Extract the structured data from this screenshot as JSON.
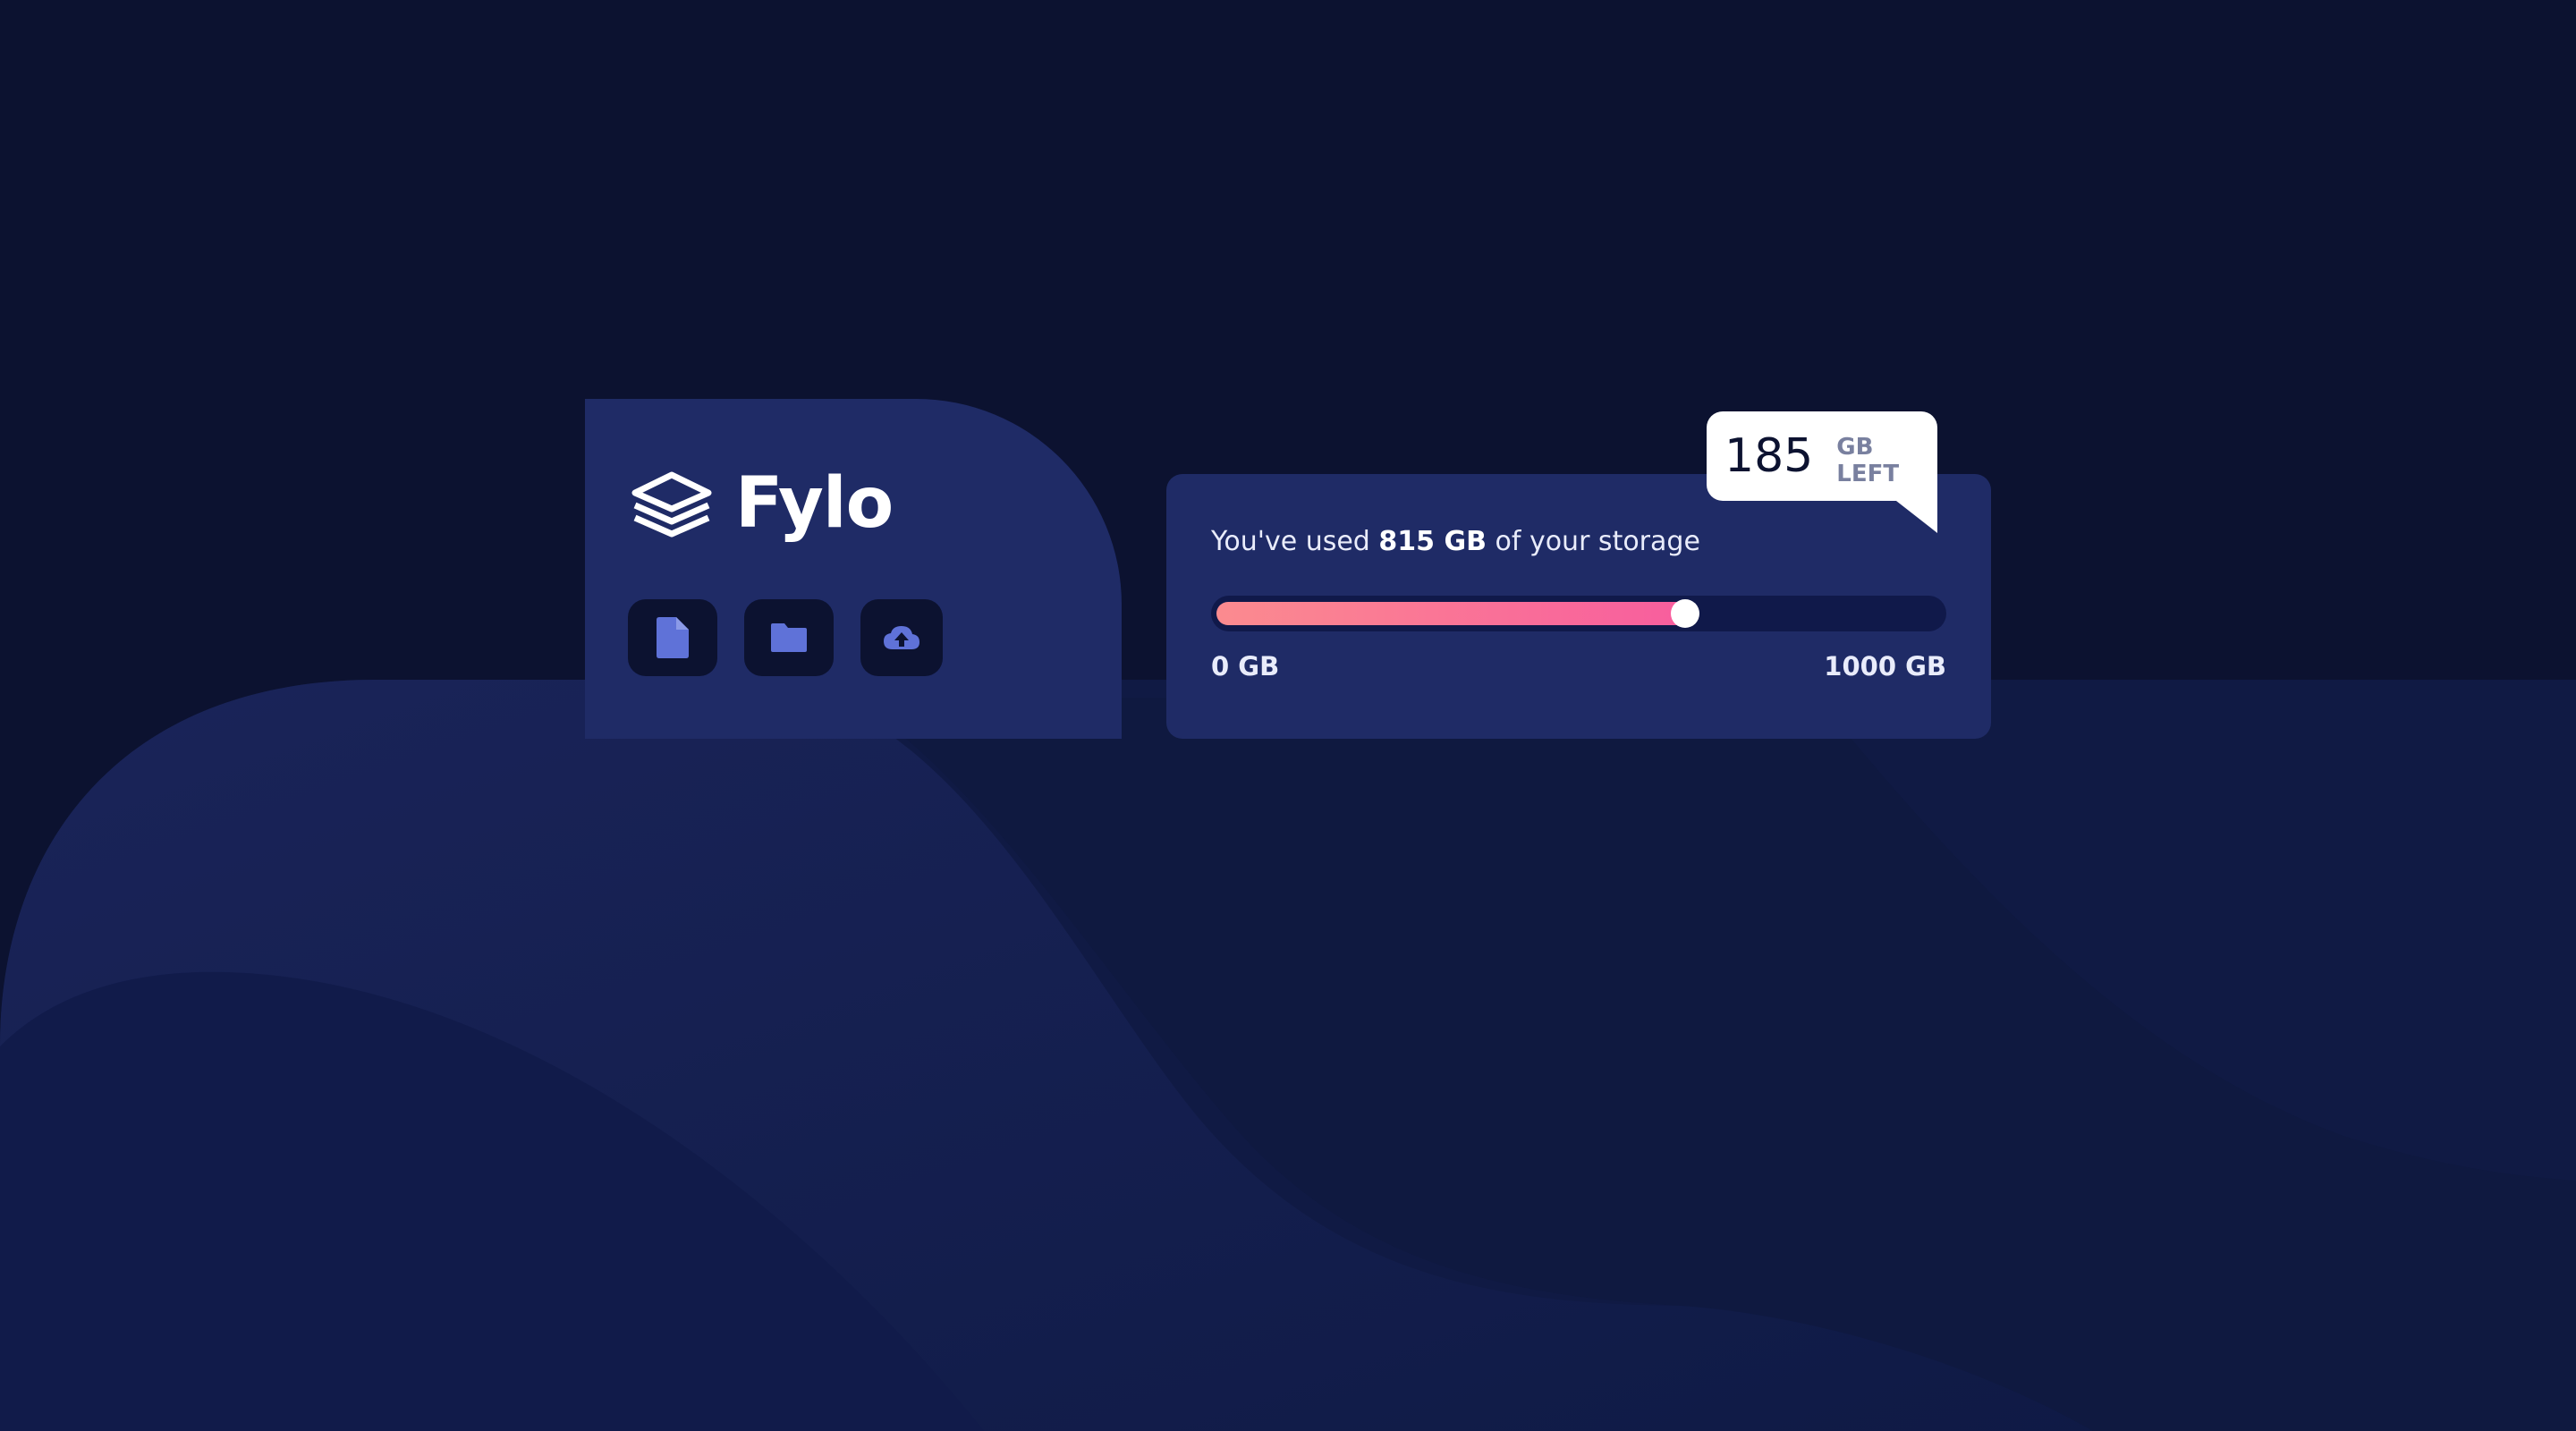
{
  "app": {
    "brand": "Fylo"
  },
  "logo_card": {
    "icons": [
      {
        "name": "document-icon"
      },
      {
        "name": "folder-icon"
      },
      {
        "name": "upload-icon"
      }
    ]
  },
  "storage": {
    "usage_prefix": "You've used ",
    "usage_amount": "815 GB",
    "usage_suffix": " of your storage",
    "used_gb": 815,
    "total_gb": 1000,
    "scale_min": "0 GB",
    "scale_max": "1000 GB",
    "remaining_number": "185",
    "remaining_unit": "GB LEFT"
  },
  "colors": {
    "background": "#0c1230",
    "card": "#1f2b66",
    "icon_accent": "#5f72d8",
    "bar_start": "#fb8b8f",
    "bar_end": "#f85d9e"
  }
}
